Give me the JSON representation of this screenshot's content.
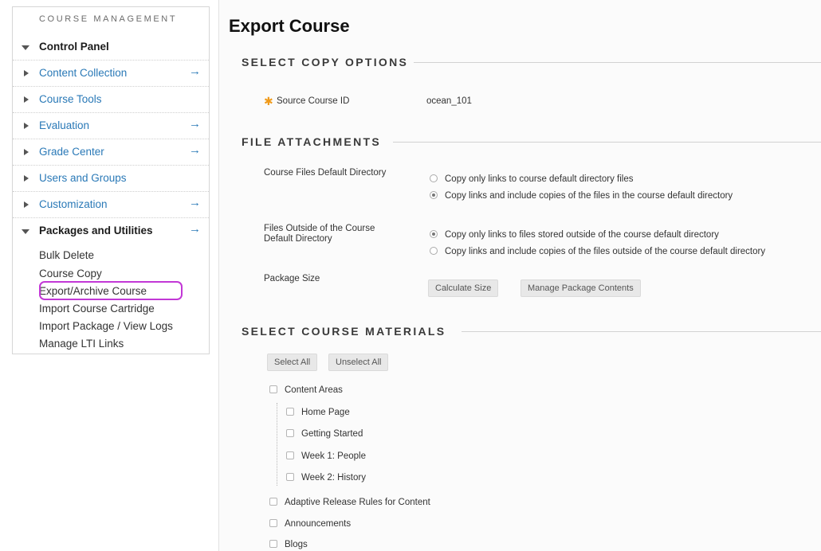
{
  "sidebar": {
    "header": "COURSE MANAGEMENT",
    "control_panel": "Control Panel",
    "items": [
      {
        "label": "Content Collection",
        "arrow": "→"
      },
      {
        "label": "Course Tools",
        "arrow": ""
      },
      {
        "label": "Evaluation",
        "arrow": "→"
      },
      {
        "label": "Grade Center",
        "arrow": "→"
      },
      {
        "label": "Users and Groups",
        "arrow": ""
      },
      {
        "label": "Customization",
        "arrow": "→"
      }
    ],
    "packages": {
      "label": "Packages and Utilities",
      "arrow": "→"
    },
    "sub_items": [
      "Bulk Delete",
      "Course Copy",
      "Export/Archive Course",
      "Import Course Cartridge",
      "Import Package / View Logs",
      "Manage LTI Links"
    ],
    "highlight_color": "#c238d6"
  },
  "main": {
    "title": "Export Course",
    "copy_options": {
      "heading": "SELECT COPY OPTIONS",
      "source_label": "Source Course ID",
      "source_value": "ocean_101"
    },
    "attachments": {
      "heading": "FILE ATTACHMENTS",
      "default_dir_label": "Course Files Default Directory",
      "default_dir_opt1": "Copy only links to course default directory files",
      "default_dir_opt2": "Copy links and include copies of the files in the course default directory",
      "outside_label_1": "Files Outside of the Course",
      "outside_label_2": "Default Directory",
      "outside_opt1": "Copy only links to files stored outside of the course default directory",
      "outside_opt2": "Copy links and include copies of the files outside of the course default directory",
      "package_size_label": "Package Size",
      "calc_btn": "Calculate Size",
      "manage_btn": "Manage Package Contents"
    },
    "materials": {
      "heading": "SELECT COURSE MATERIALS",
      "select_all": "Select All",
      "unselect_all": "Unselect All",
      "content_areas": "Content Areas",
      "areas": [
        "Home Page",
        "Getting Started",
        "Week 1: People",
        "Week 2: History"
      ],
      "adaptive": "Adaptive Release Rules for Content",
      "announcements": "Announcements",
      "blogs": "Blogs"
    }
  }
}
